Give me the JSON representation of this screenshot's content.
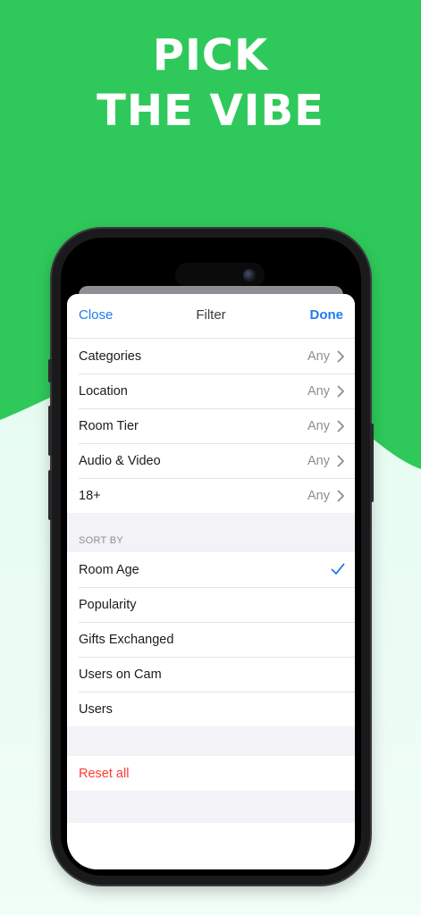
{
  "headline": {
    "line1": "PICK",
    "line2": "THE VIBE"
  },
  "colors": {
    "brand_green": "#2fc95b",
    "link_blue": "#1f7cf0",
    "destructive_red": "#ff3b30"
  },
  "filter": {
    "nav": {
      "close_label": "Close",
      "title": "Filter",
      "done_label": "Done"
    },
    "filters": [
      {
        "label": "Categories",
        "value": "Any",
        "icon": "chevron-right-icon"
      },
      {
        "label": "Location",
        "value": "Any",
        "icon": "chevron-right-icon"
      },
      {
        "label": "Room Tier",
        "value": "Any",
        "icon": "chevron-right-icon"
      },
      {
        "label": "Audio & Video",
        "value": "Any",
        "icon": "chevron-right-icon"
      },
      {
        "label": "18+",
        "value": "Any",
        "icon": "chevron-right-icon"
      }
    ],
    "sort_by": {
      "header": "SORT BY",
      "options": [
        {
          "label": "Room Age",
          "selected": true
        },
        {
          "label": "Popularity",
          "selected": false
        },
        {
          "label": "Gifts Exchanged",
          "selected": false
        },
        {
          "label": "Users on Cam",
          "selected": false
        },
        {
          "label": "Users",
          "selected": false
        }
      ]
    },
    "reset_label": "Reset all"
  }
}
